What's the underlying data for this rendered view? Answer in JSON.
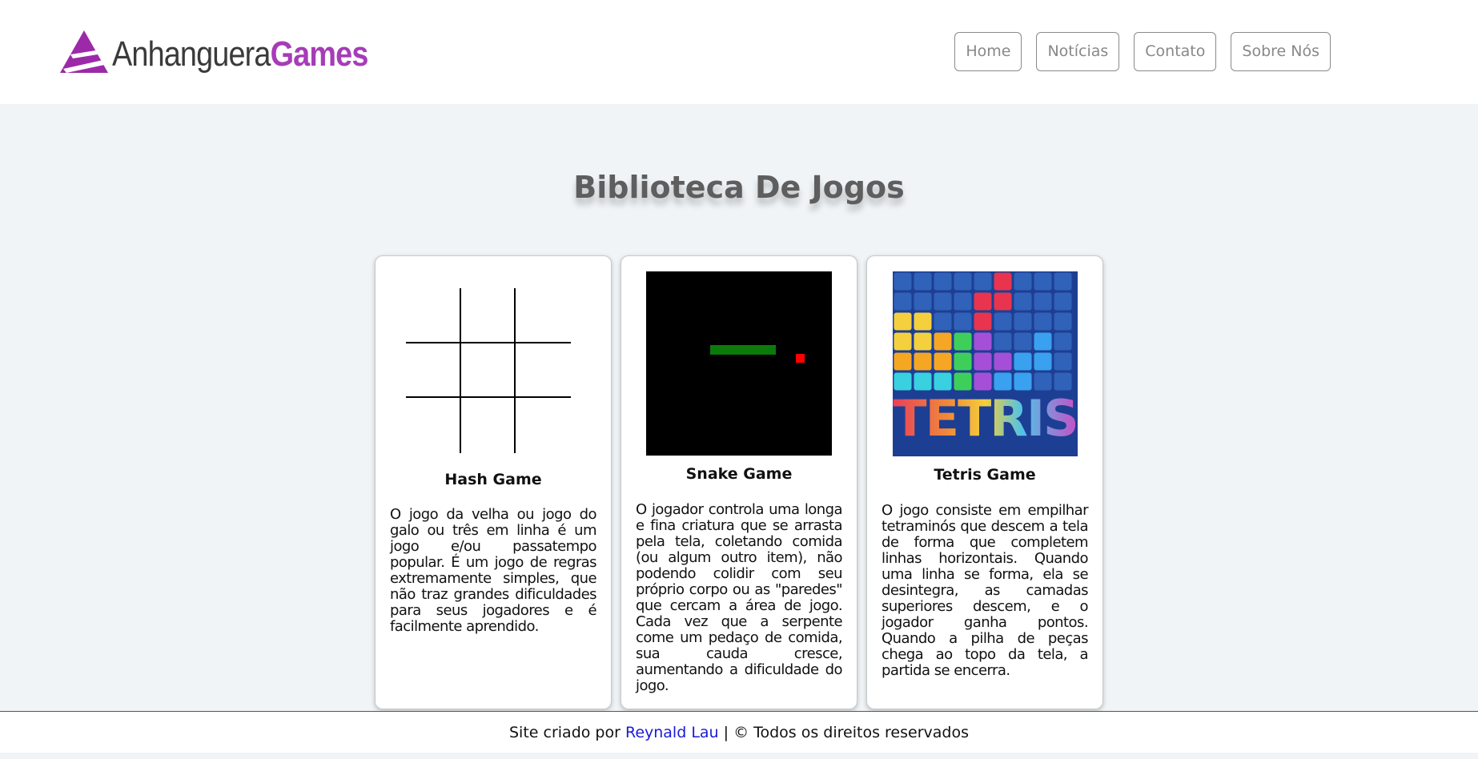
{
  "brand": {
    "name_part1": "Anhanguera",
    "name_part2": "Games",
    "accent_color": "#a63cb8"
  },
  "nav": [
    {
      "label": "Home"
    },
    {
      "label": "Notícias"
    },
    {
      "label": "Contato"
    },
    {
      "label": "Sobre Nós"
    }
  ],
  "page_title": "Biblioteca De Jogos",
  "games": [
    {
      "title": "Hash Game",
      "image_icon": "tic-tac-toe-grid",
      "description": "O jogo da velha ou jogo do galo ou três em linha é um jogo e/ou passatempo popular. É um jogo de regras extremamente simples, que não traz grandes dificuldades para seus jogadores e é facilmente aprendido."
    },
    {
      "title": "Snake Game",
      "image_icon": "snake-game-screen",
      "description": "O jogador controla uma longa e fina criatura que se arrasta pela tela, coletando comida (ou algum outro item), não podendo colidir com seu próprio corpo ou as \"paredes\" que cercam a área de jogo. Cada vez que a serpente come um pedaço de comida, sua cauda cresce, aumentando a dificuldade do jogo."
    },
    {
      "title": "Tetris Game",
      "image_icon": "tetris-logo",
      "image_text": "TETRIS",
      "description": "O jogo consiste em empilhar tetraminós que descem a tela de forma que completem linhas horizontais. Quando uma linha se forma, ela se desintegra, as camadas superiores descem, e o jogador ganha pontos. Quando a pilha de peças chega ao topo da tela, a partida se encerra."
    }
  ],
  "footer": {
    "prefix": "Site criado por ",
    "author": "Reynald Lau",
    "suffix": " | © Todos os direitos reservados"
  }
}
